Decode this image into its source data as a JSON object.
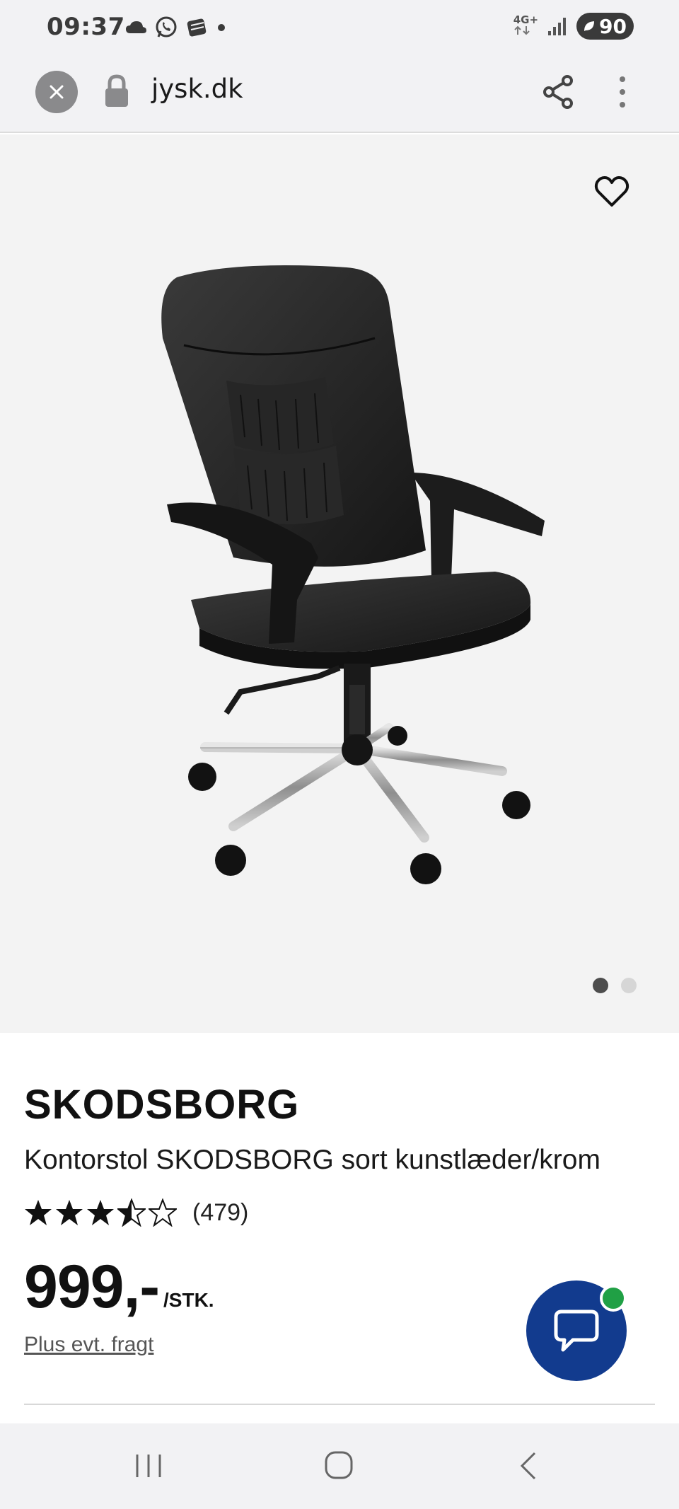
{
  "status_bar": {
    "time": "09:37",
    "network": "4G+",
    "battery": "90",
    "icons_left": [
      "cloud-icon",
      "whatsapp-icon",
      "stack-icon",
      "dot-icon"
    ]
  },
  "browser": {
    "url": "jysk.dk"
  },
  "gallery": {
    "image_count": 2,
    "active_index": 0
  },
  "product": {
    "brand": "SKODSBORG",
    "title": "Kontorstol SKODSBORG sort kunstlæder/krom",
    "rating": 3.5,
    "rating_max": 5,
    "review_count": "(479)",
    "price": "999,-",
    "unit": "/STK.",
    "shipping_note": "Plus evt. fragt"
  },
  "colors": {
    "accent": "#123b8e",
    "online_badge": "#20a045"
  }
}
